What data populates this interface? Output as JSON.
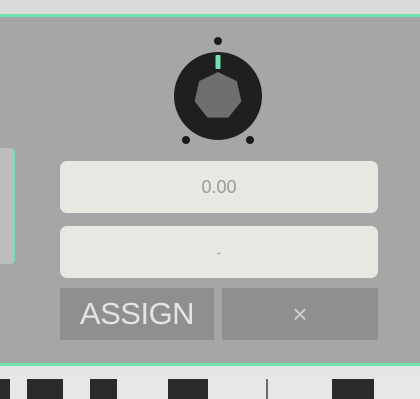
{
  "knob": {
    "value": 0.0
  },
  "value_display": "0.00",
  "mapping_display": "-",
  "assign_button_label": "ASSIGN",
  "clear_button_label": "×",
  "colors": {
    "panel": "#a6a6a6",
    "accent": "#6ee3b0",
    "field": "#e8e7e1",
    "button": "#8f8f8f",
    "knob_body": "#1f1f1f",
    "knob_cap": "#6f6f6f"
  },
  "icons": [
    "knob-icon",
    "close-icon"
  ]
}
